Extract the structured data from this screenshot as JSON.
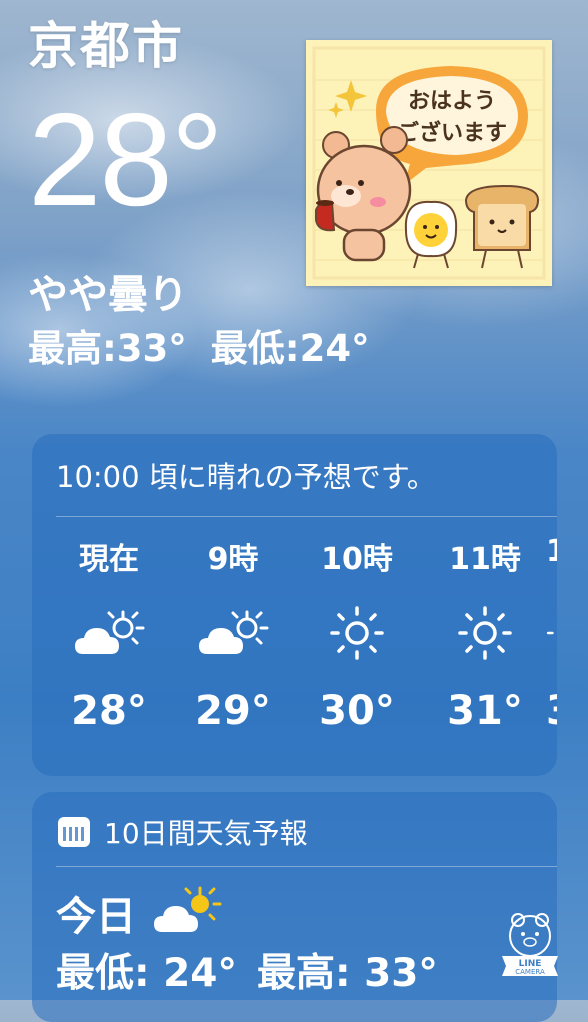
{
  "location": {
    "city": "京都市",
    "temperature": "28°",
    "condition": "やや曇り",
    "high": "最高:33°",
    "low": "最低:24°"
  },
  "sticker": {
    "bubble_line1": "おはよう",
    "bubble_line2": "ございます",
    "bubble_color": "#f6a63a"
  },
  "hourly": {
    "summary": "10:00 頃に晴れの予想です。",
    "items": [
      {
        "label": "現在",
        "icon": "partly-cloudy-icon",
        "temp": "28°"
      },
      {
        "label": "9時",
        "icon": "partly-cloudy-icon",
        "temp": "29°"
      },
      {
        "label": "10時",
        "icon": "sun-icon",
        "temp": "30°"
      },
      {
        "label": "11時",
        "icon": "sun-icon",
        "temp": "31°"
      },
      {
        "label": "1",
        "icon": "sun-icon",
        "temp": "3"
      }
    ]
  },
  "forecast": {
    "header": "10日間天気予報",
    "today_label": "今日",
    "today_icon": "partly-cloudy-sun-icon",
    "today_low": "最低: 24°",
    "today_high": "最高: 33°"
  },
  "watermark": {
    "line1": "LINE",
    "line2": "CAMERA"
  },
  "colors": {
    "card_bg": "#2d6fbf",
    "sun_yellow": "#f5c518"
  }
}
